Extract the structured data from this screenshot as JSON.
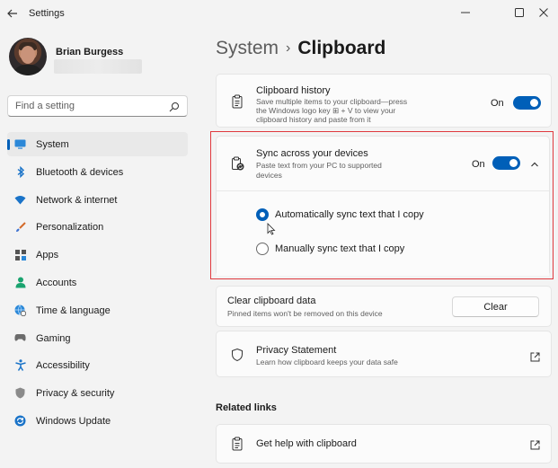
{
  "window": {
    "title": "Settings"
  },
  "profile": {
    "name": "Brian Burgess"
  },
  "search": {
    "placeholder": "Find a setting"
  },
  "sidebar": {
    "items": [
      {
        "label": "System",
        "icon": "system-icon",
        "active": true
      },
      {
        "label": "Bluetooth & devices",
        "icon": "bluetooth-icon"
      },
      {
        "label": "Network & internet",
        "icon": "wifi-icon"
      },
      {
        "label": "Personalization",
        "icon": "brush-icon"
      },
      {
        "label": "Apps",
        "icon": "apps-icon"
      },
      {
        "label": "Accounts",
        "icon": "person-icon"
      },
      {
        "label": "Time & language",
        "icon": "globe-clock-icon"
      },
      {
        "label": "Gaming",
        "icon": "gamepad-icon"
      },
      {
        "label": "Accessibility",
        "icon": "accessibility-icon"
      },
      {
        "label": "Privacy & security",
        "icon": "shield-icon"
      },
      {
        "label": "Windows Update",
        "icon": "update-icon"
      }
    ]
  },
  "header": {
    "parent": "System",
    "separator": "›",
    "current": "Clipboard"
  },
  "clipboard_history": {
    "title": "Clipboard history",
    "description_line1": "Save multiple items to your clipboard—press",
    "description_line2": "the Windows logo key ⊞ + V to view your",
    "description_line3": "clipboard history and paste from it",
    "state": "On"
  },
  "sync": {
    "title": "Sync across your devices",
    "description_line1": "Paste text from your PC to supported",
    "description_line2": "devices",
    "state": "On",
    "options": [
      {
        "label": "Automatically sync text that I copy",
        "checked": true
      },
      {
        "label": "Manually sync text that I copy",
        "checked": false
      }
    ]
  },
  "clear": {
    "title": "Clear clipboard data",
    "description": "Pinned items won't be removed on this device",
    "button": "Clear"
  },
  "privacy": {
    "title": "Privacy Statement",
    "description": "Learn how clipboard keeps your data safe"
  },
  "related": {
    "heading": "Related links",
    "help": "Get help with clipboard"
  },
  "colors": {
    "accent": "#005fb8",
    "highlight_border": "#e0393e"
  }
}
